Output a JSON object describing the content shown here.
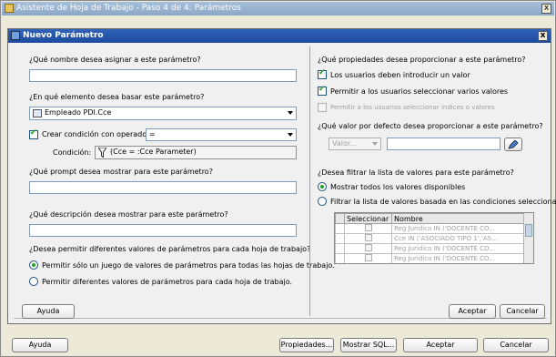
{
  "outer_dialog": {
    "title": "Asistente de Hoja de Trabajo - Paso 4 de 4: Parámetros",
    "close": "x",
    "buttons": {
      "help": "Ayuda",
      "properties": "Propiedades...",
      "show_sql": "Mostrar SQL...",
      "accept": "Aceptar",
      "cancel": "Cancelar"
    }
  },
  "inner_dialog": {
    "title": "Nuevo Parámetro",
    "close": "x",
    "left": {
      "name_question": "¿Qué nombre desea asignar a este parámetro?",
      "name_value": "",
      "base_question": "¿En qué elemento desea basar este parámetro?",
      "base_value": "Empleado PDI.Cce",
      "create_condition_label": "Crear condición con operador:",
      "operator_value": "=",
      "condition_label": "Condición:",
      "condition_value": "(Cce = :Cce Parameter)",
      "prompt_question": "¿Qué prompt desea mostrar para este parámetro?",
      "prompt_value": "",
      "description_question": "¿Qué descripción desea mostrar para este parámetro?",
      "description_value": "",
      "multi_question": "¿Desea permitir diferentes valores de parámetros para cada hoja de trabajo?",
      "option_one": "Permitir sólo un juego de valores de parámetros para todas las hojas de trabajo.",
      "option_diff": "Permitir diferentes valores de parámetros para cada hoja de trabajo."
    },
    "right": {
      "props_question": "¿Qué propiedades desea proporcionar a este parámetro?",
      "users_must_enter": "Los usuarios deben introducir un valor",
      "allow_multiple": "Permitir a los usuarios seleccionar varios valores",
      "allow_indices": "Permitir a los usuarios seleccionar índices o valores",
      "default_question": "¿Qué valor por defecto desea proporcionar a este parámetro?",
      "value_dropdown": "Valor...",
      "default_value": "",
      "filter_question": "¿Desea filtrar la lista de valores para este parámetro?",
      "show_all": "Mostrar todos los valores disponibles",
      "filter_conditions": "Filtrar la lista de valores basada en las condiciones seleccionadas:",
      "table": {
        "headers": [
          "Seleccionar",
          "Nombre"
        ],
        "rows": [
          "Reg Juridico IN ('DOCENTE CO...",
          "Cce IN ('ASOCIADO TIPO 1','AS...",
          "Reg Juridico IN ('DOCENTE CO...",
          "Reg Juridico IN ('DOCENTE CO..."
        ]
      }
    },
    "buttons": {
      "help": "Ayuda",
      "accept": "Aceptar",
      "cancel": "Cancelar"
    }
  }
}
